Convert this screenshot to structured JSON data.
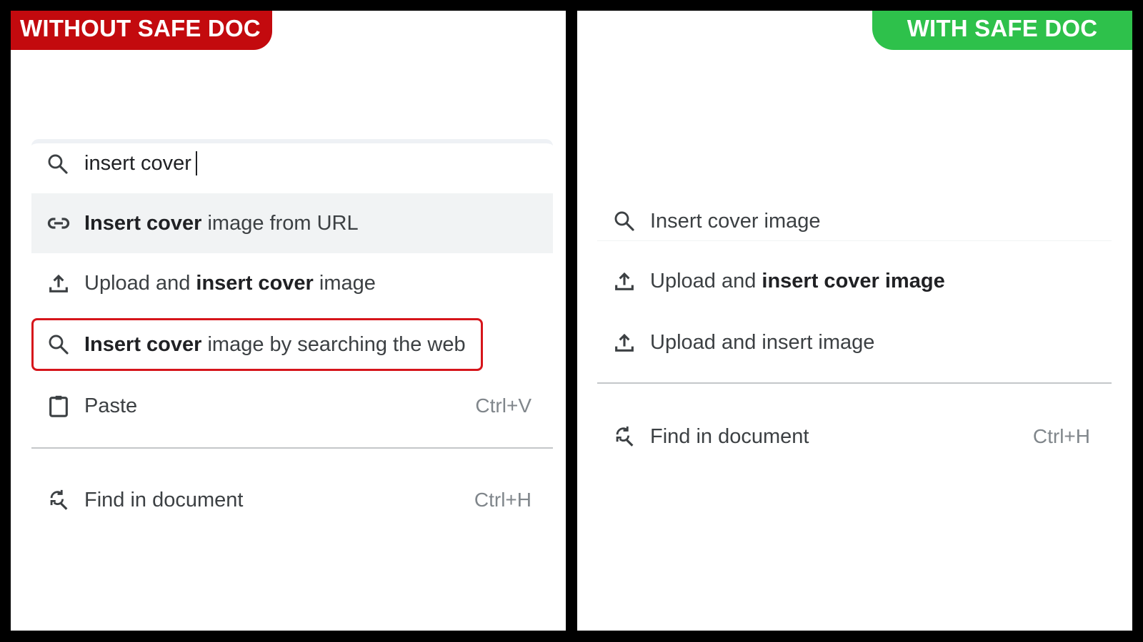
{
  "banners": {
    "left": {
      "label": "WITHOUT SAFE DOC",
      "color": "#c30a0e"
    },
    "right": {
      "label": "WITH SAFE DOC",
      "color": "#2ec14b"
    }
  },
  "left_panel": {
    "search": {
      "value": "insert cover",
      "icon": "search-icon"
    },
    "items": [
      {
        "icon": "link-icon",
        "bold": "Insert cover",
        "rest": " image from URL",
        "highlighted": true
      },
      {
        "icon": "upload-icon",
        "pre": "Upload and ",
        "bold": "insert cover",
        "rest": " image"
      },
      {
        "icon": "search-icon",
        "bold": "Insert cover",
        "rest": " image by searching the web",
        "flagged": true,
        "flag_color": "#d6151b"
      },
      {
        "icon": "clipboard-icon",
        "label": "Paste",
        "shortcut": "Ctrl+V"
      },
      {
        "icon": "find-replace-icon",
        "label": "Find in document",
        "shortcut": "Ctrl+H"
      }
    ]
  },
  "right_panel": {
    "items": [
      {
        "icon": "search-icon",
        "label": "Insert cover image"
      },
      {
        "icon": "upload-icon",
        "pre": "Upload and ",
        "bold": "insert cover image"
      },
      {
        "icon": "upload-icon",
        "label": "Upload and insert image"
      },
      {
        "icon": "find-replace-icon",
        "label": "Find in document",
        "shortcut": "Ctrl+H"
      }
    ]
  }
}
